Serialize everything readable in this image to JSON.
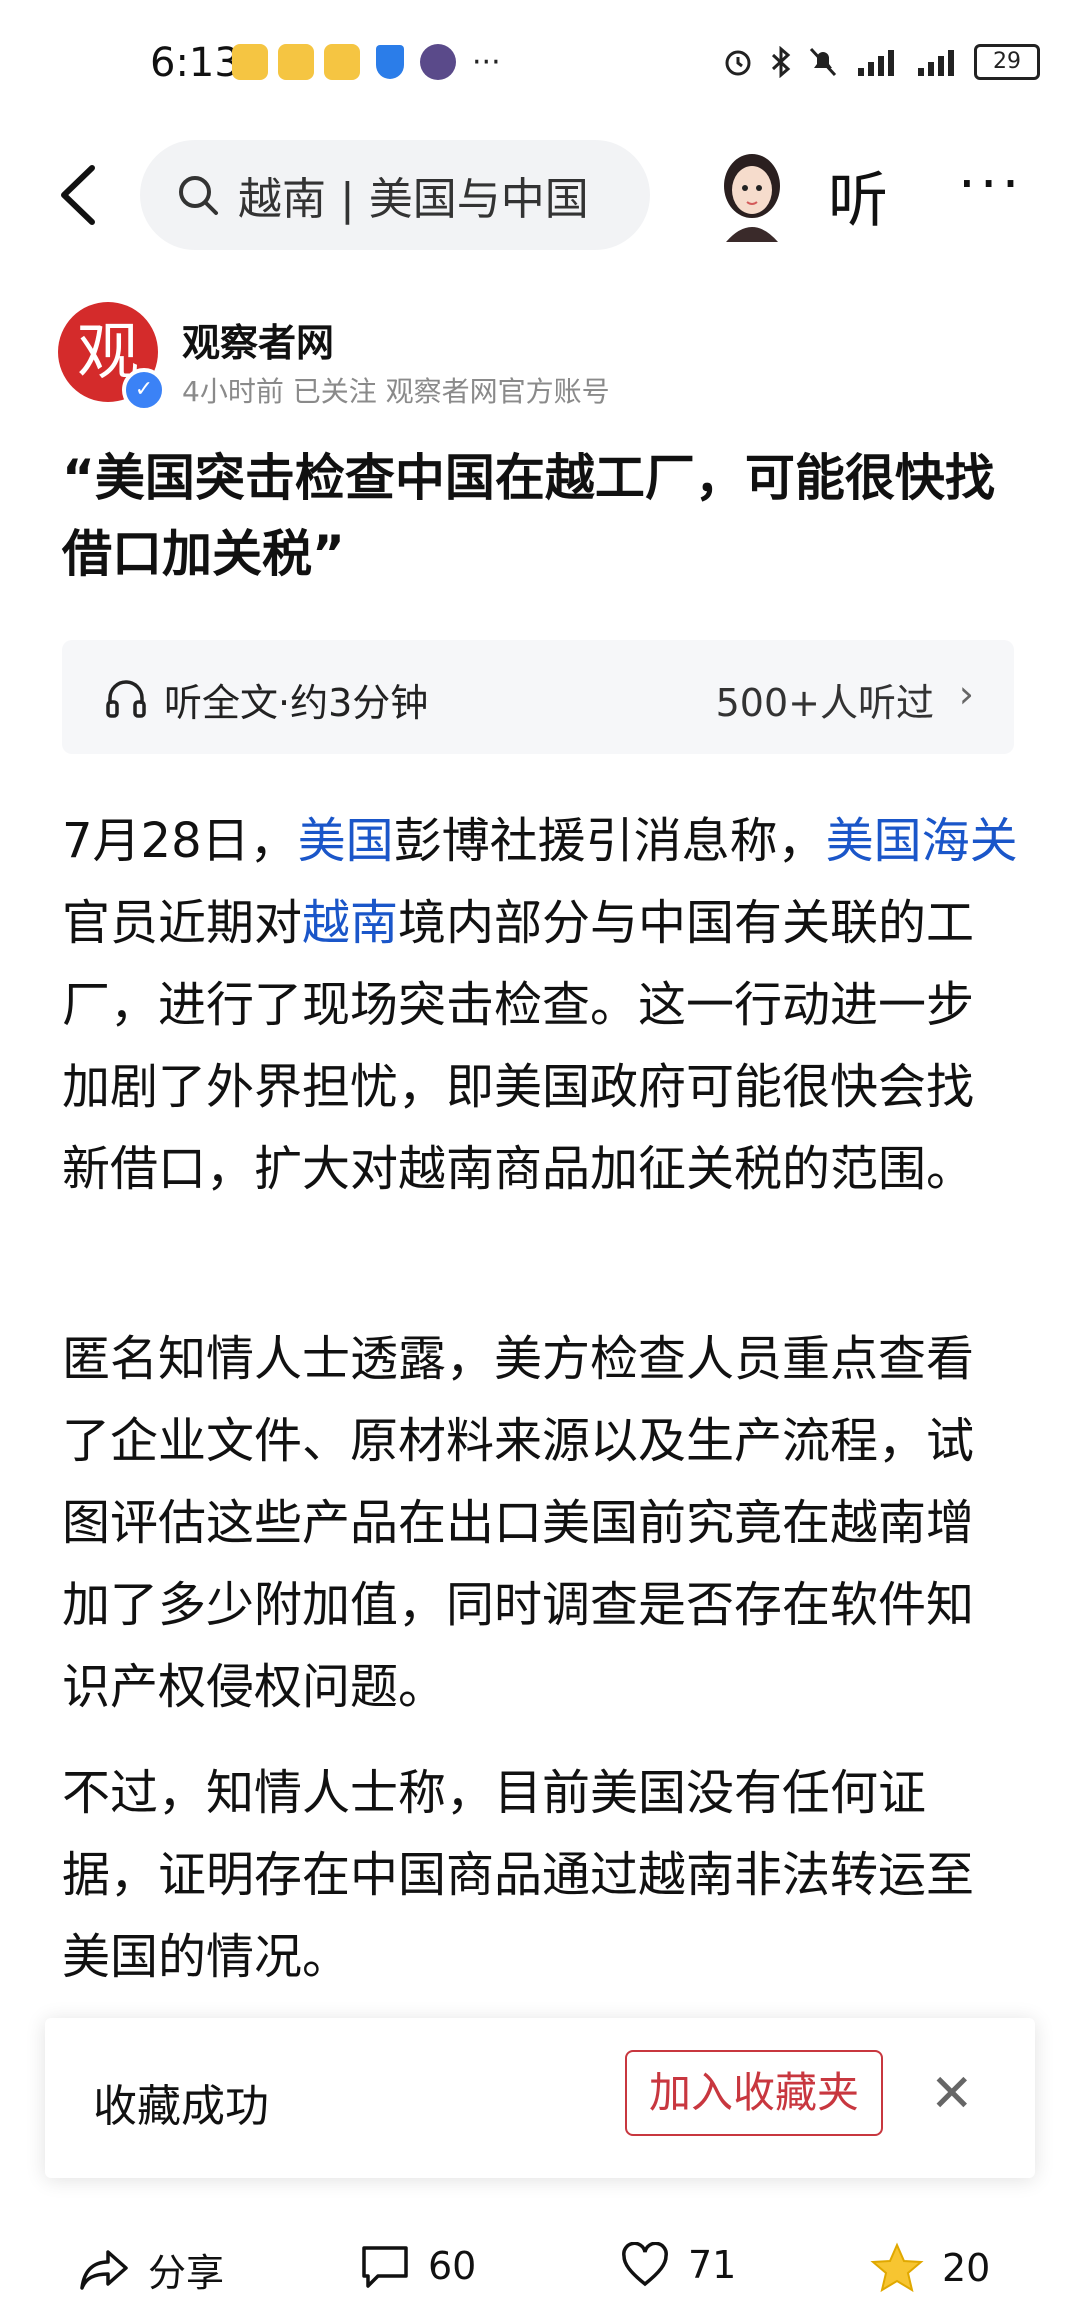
{
  "status_bar": {
    "time": "6:13",
    "more": "···",
    "battery": "29"
  },
  "nav": {
    "search_text": "越南 | 美国与中国",
    "listen_label": "听",
    "more_label": "···"
  },
  "author": {
    "logo_char": "观",
    "name": "观察者网",
    "meta": "4小时前  已关注  观察者网官方账号"
  },
  "article": {
    "title": "“美国突击检查中国在越工厂，可能很快找借口加关税”",
    "listen_bar": {
      "label": "听全文·约3分钟",
      "count": "500+人听过"
    },
    "p1": {
      "a": "7月28日，",
      "k1": "美国",
      "b": "彭博社援引消息称，",
      "k2": "美国海关",
      "c": "官员近期对",
      "k3": "越南",
      "d": "境内部分与中国有关联的工厂，进行了现场突击检查。这一行动进一步加剧了外界担忧，即美国政府可能很快会找新借口，扩大对越南商品加征关税的范围。"
    },
    "p2": "匿名知情人士透露，美方检查人员重点查看了企业文件、原材料来源以及生产流程，试图评估这些产品在出口美国前究竟在越南增加了多少附加值，同时调查是否存在软件知识产权侵权问题。",
    "p3": "不过，知情人士称，目前美国没有任何证据，证明存在中国商品通过越南非法转运至美国的情况。"
  },
  "toast": {
    "text": "收藏成功",
    "button": "加入收藏夹",
    "close": "✕"
  },
  "bottom_bar": {
    "share_label": "分享",
    "comments": "60",
    "likes": "71",
    "favorites": "20"
  },
  "colors": {
    "link_blue": "#1a56c9",
    "brand_red": "#d42b2b",
    "toast_red": "#c8373f"
  }
}
